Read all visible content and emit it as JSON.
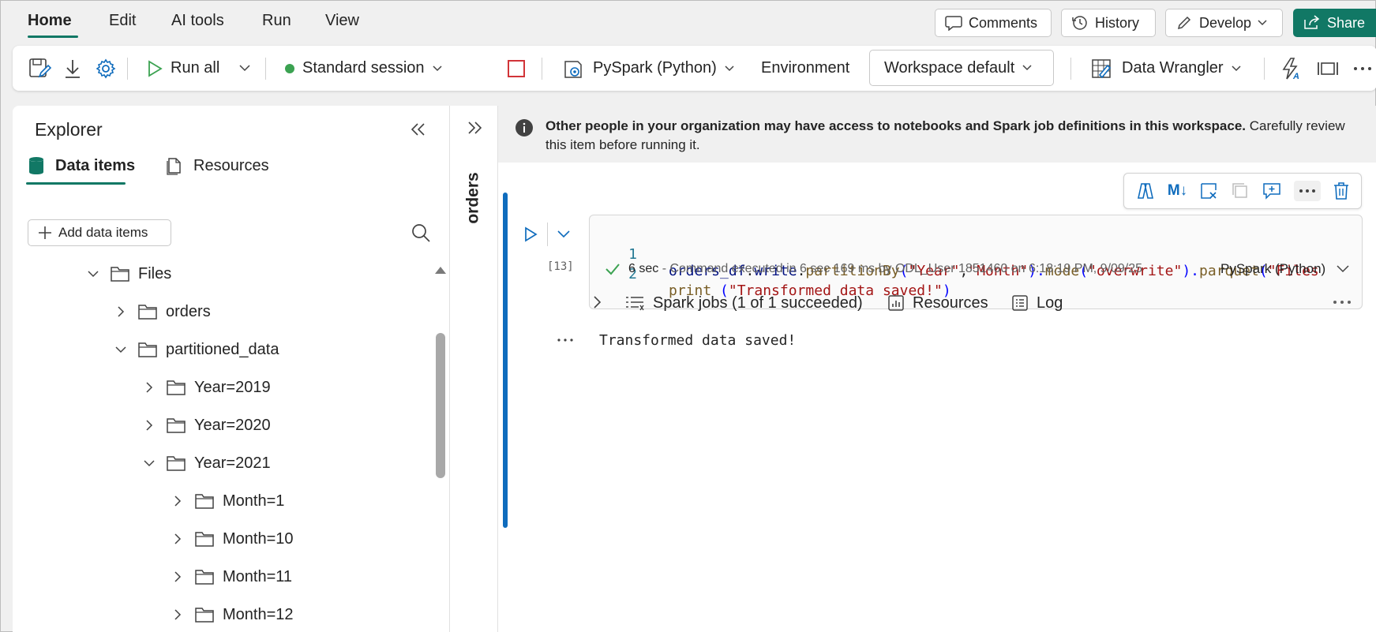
{
  "menu": {
    "tabs": [
      "Home",
      "Edit",
      "AI tools",
      "Run",
      "View"
    ],
    "active": "Home",
    "comments": "Comments",
    "history": "History",
    "develop": "Develop",
    "share": "Share"
  },
  "ribbon": {
    "run_all": "Run all",
    "session": "Standard session",
    "language": "PySpark (Python)",
    "environment_label": "Environment",
    "environment_value": "Workspace default",
    "data_wrangler": "Data Wrangler"
  },
  "explorer": {
    "title": "Explorer",
    "tabs": {
      "data_items": "Data items",
      "resources": "Resources"
    },
    "add_button": "Add data items",
    "tree": {
      "files": "Files",
      "orders": "orders",
      "partitioned_data": "partitioned_data",
      "year2019": "Year=2019",
      "year2020": "Year=2020",
      "year2021": "Year=2021",
      "month1": "Month=1",
      "month10": "Month=10",
      "month11": "Month=11",
      "month12": "Month=12"
    }
  },
  "side_panel": {
    "label": "orders"
  },
  "notebook": {
    "banner_bold": "Other people in your organization may have access to notebooks and Spark job definitions in this workspace.",
    "banner_rest": " Carefully review this item before running it.",
    "cell": {
      "execution_count": "[13]",
      "line1_number": "1",
      "line2_number": "2",
      "line1": {
        "a": "orders_df",
        "b": ".",
        "c": "write",
        "d": ".",
        "e": "partitionBy",
        "f": "(",
        "g": "\"Year\"",
        "h": ",",
        "i": "\"Month\"",
        "j": ").",
        "k": "mode",
        "l": "(",
        "m": "\"overwrite\"",
        "n": ").",
        "o": "parquet",
        "p": "(",
        "q": "\"Files"
      },
      "line2": {
        "a": "print",
        "b": " (",
        "c": "\"Transformed data saved!\"",
        "d": ")"
      },
      "status_time": "6 sec",
      "status_detail": " - Command executed in 6 sec 169 ms by ODL_User 1851460 on 6:18:19 PM, 9/09/25",
      "status_language": "PySpark (Python)",
      "spark_jobs": "Spark jobs (1 of 1 succeeded)",
      "resources": "Resources",
      "log": "Log",
      "output": "Transformed data saved!"
    }
  },
  "colors": {
    "accent": "#117865",
    "run_blue": "#0f6cbd",
    "session_green": "#3ba251",
    "stop_red": "#d13438"
  }
}
